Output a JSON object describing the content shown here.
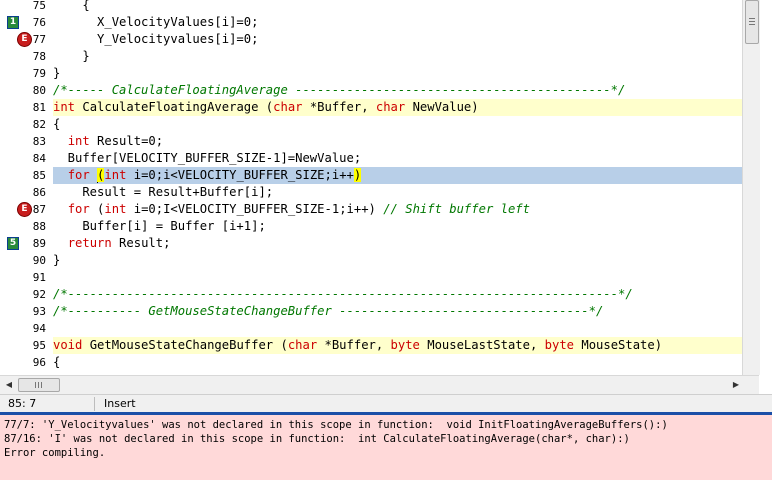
{
  "editor": {
    "lines": [
      {
        "num": "75",
        "segs": [
          {
            "t": "    {",
            "c": ""
          }
        ],
        "hl": "",
        "marker": ""
      },
      {
        "num": "76",
        "segs": [
          {
            "t": "      X_VelocityValues[i]=0;",
            "c": ""
          }
        ],
        "hl": "",
        "marker": "bookmark",
        "marker_label": "1"
      },
      {
        "num": "77",
        "segs": [
          {
            "t": "      Y_Velocityvalues[i]=0;",
            "c": ""
          }
        ],
        "hl": "",
        "marker": "error",
        "marker_label": "E"
      },
      {
        "num": "78",
        "segs": [
          {
            "t": "    }",
            "c": ""
          }
        ],
        "hl": "",
        "marker": ""
      },
      {
        "num": "79",
        "segs": [
          {
            "t": "}",
            "c": ""
          }
        ],
        "hl": "",
        "marker": ""
      },
      {
        "num": "80",
        "segs": [
          {
            "t": "/*----- CalculateFloatingAverage -------------------------------------------*/",
            "c": "cm"
          }
        ],
        "hl": "",
        "marker": ""
      },
      {
        "num": "81",
        "segs": [
          {
            "t": "int",
            "c": "kw"
          },
          {
            "t": " CalculateFloatingAverage (",
            "c": ""
          },
          {
            "t": "char",
            "c": "kw"
          },
          {
            "t": " *Buffer, ",
            "c": ""
          },
          {
            "t": "char",
            "c": "kw"
          },
          {
            "t": " NewValue)",
            "c": ""
          }
        ],
        "hl": "yellow",
        "marker": ""
      },
      {
        "num": "82",
        "segs": [
          {
            "t": "{",
            "c": ""
          }
        ],
        "hl": "",
        "marker": ""
      },
      {
        "num": "83",
        "segs": [
          {
            "t": "  ",
            "c": ""
          },
          {
            "t": "int",
            "c": "kw"
          },
          {
            "t": " Result=0;",
            "c": ""
          }
        ],
        "hl": "",
        "marker": ""
      },
      {
        "num": "84",
        "segs": [
          {
            "t": "  Buffer[VELOCITY_BUFFER_SIZE-1]=NewValue;",
            "c": ""
          }
        ],
        "hl": "",
        "marker": ""
      },
      {
        "num": "85",
        "segs": [
          {
            "t": "  ",
            "c": ""
          },
          {
            "t": "for",
            "c": "kw"
          },
          {
            "t": " ",
            "c": ""
          },
          {
            "t": "CARET",
            "c": "caret"
          },
          {
            "t": "(",
            "c": "brk"
          },
          {
            "t": "int",
            "c": "kw"
          },
          {
            "t": " i=0;i<VELOCITY_BUFFER_SIZE;i++",
            "c": ""
          },
          {
            "t": ")",
            "c": "brk"
          }
        ],
        "hl": "blue",
        "marker": ""
      },
      {
        "num": "86",
        "segs": [
          {
            "t": "    Result = Result+Buffer[i];",
            "c": ""
          }
        ],
        "hl": "",
        "marker": ""
      },
      {
        "num": "87",
        "segs": [
          {
            "t": "  ",
            "c": ""
          },
          {
            "t": "for",
            "c": "kw"
          },
          {
            "t": " (",
            "c": ""
          },
          {
            "t": "int",
            "c": "kw"
          },
          {
            "t": " i=0;I<VELOCITY_BUFFER_SIZE-1;i++) ",
            "c": ""
          },
          {
            "t": "// Shift buffer left",
            "c": "cm"
          }
        ],
        "hl": "",
        "marker": "error",
        "marker_label": "E"
      },
      {
        "num": "88",
        "segs": [
          {
            "t": "    Buffer[i] = Buffer [i+1];",
            "c": ""
          }
        ],
        "hl": "",
        "marker": ""
      },
      {
        "num": "89",
        "segs": [
          {
            "t": "  ",
            "c": ""
          },
          {
            "t": "return",
            "c": "kw"
          },
          {
            "t": " Result;",
            "c": ""
          }
        ],
        "hl": "",
        "marker": "bookmark",
        "marker_label": "5"
      },
      {
        "num": "90",
        "segs": [
          {
            "t": "}",
            "c": ""
          }
        ],
        "hl": "",
        "marker": ""
      },
      {
        "num": "91",
        "segs": [
          {
            "t": "",
            "c": ""
          }
        ],
        "hl": "",
        "marker": ""
      },
      {
        "num": "92",
        "segs": [
          {
            "t": "/*---------------------------------------------------------------------------*/",
            "c": "cm"
          }
        ],
        "hl": "",
        "marker": ""
      },
      {
        "num": "93",
        "segs": [
          {
            "t": "/*---------- GetMouseStateChangeBuffer ----------------------------------*/",
            "c": "cm"
          }
        ],
        "hl": "",
        "marker": ""
      },
      {
        "num": "94",
        "segs": [
          {
            "t": "",
            "c": ""
          }
        ],
        "hl": "",
        "marker": ""
      },
      {
        "num": "95",
        "segs": [
          {
            "t": "void",
            "c": "kw"
          },
          {
            "t": " GetMouseStateChangeBuffer (",
            "c": ""
          },
          {
            "t": "char",
            "c": "kw"
          },
          {
            "t": " *Buffer, ",
            "c": ""
          },
          {
            "t": "byte",
            "c": "kw"
          },
          {
            "t": " MouseLastState, ",
            "c": ""
          },
          {
            "t": "byte",
            "c": "kw"
          },
          {
            "t": " MouseState)",
            "c": ""
          }
        ],
        "hl": "yellow",
        "marker": ""
      },
      {
        "num": "96",
        "segs": [
          {
            "t": "{",
            "c": ""
          }
        ],
        "hl": "",
        "marker": ""
      }
    ]
  },
  "scrollbars": {
    "left_arrow": "◀",
    "right_arrow": "▶"
  },
  "status": {
    "position": "85: 7",
    "mode": "Insert"
  },
  "console": {
    "lines": [
      "77/7: 'Y_Velocityvalues' was not declared in this scope in function:  void InitFloatingAverageBuffers():)",
      "87/16: 'I' was not declared in this scope in function:  int CalculateFloatingAverage(char*, char):)",
      "Error compiling."
    ]
  },
  "colors": {
    "keyword": "#cc0000",
    "comment": "#007700",
    "current_line": "#b8cfe8",
    "function_line": "#ffffcc",
    "console_bg": "#ffd9d9",
    "divider": "#1b4fa7"
  }
}
